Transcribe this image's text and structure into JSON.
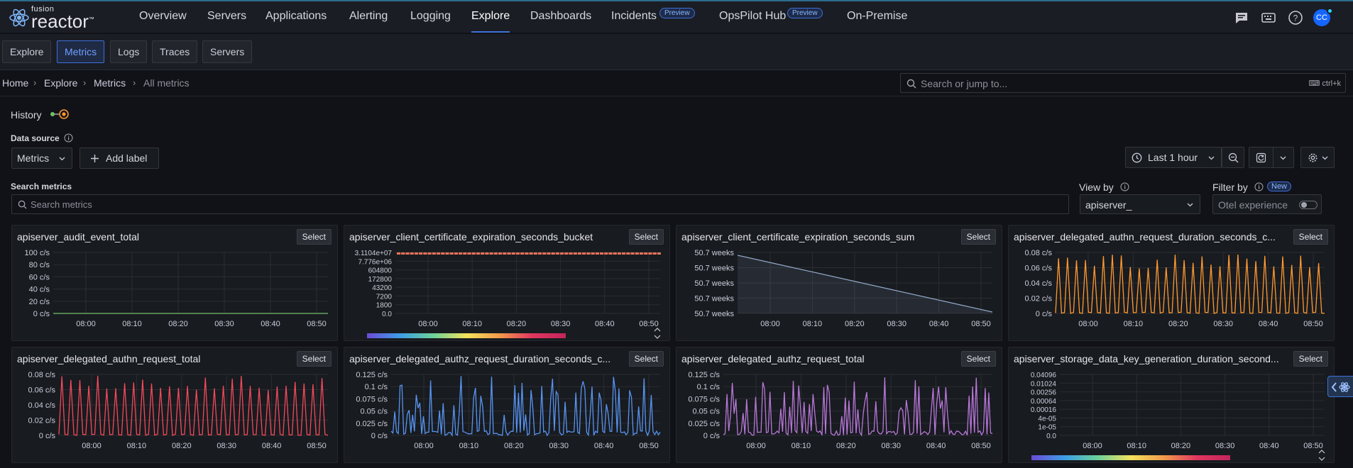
{
  "brand": {
    "top": "fusion",
    "bottom": "reactor",
    "tm": "™"
  },
  "nav": {
    "items": [
      "Overview",
      "Servers",
      "Applications",
      "Alerting",
      "Logging",
      "Explore",
      "Dashboards",
      "Incidents",
      "OpsPilot Hub",
      "On-Premise"
    ],
    "active": "Explore",
    "preview_label": "Preview"
  },
  "user": {
    "initials": "CC"
  },
  "subnav": {
    "items": [
      "Explore",
      "Metrics",
      "Logs",
      "Traces",
      "Servers"
    ],
    "active": "Metrics"
  },
  "breadcrumb": {
    "home": "Home",
    "explore": "Explore",
    "metrics": "Metrics",
    "current": "All metrics"
  },
  "jump": {
    "placeholder": "Search or jump to...",
    "shortcut": "ctrl+k"
  },
  "history_label": "History",
  "data_source": {
    "label": "Data source",
    "value": "Metrics"
  },
  "add_label": "Add label",
  "time_range": "Last 1 hour",
  "search_metrics": {
    "label": "Search metrics",
    "placeholder": "Search metrics"
  },
  "view_by": {
    "label": "View by",
    "value": "apiserver_"
  },
  "filter_by": {
    "label": "Filter by",
    "badge": "New",
    "toggle_label": "Otel experience"
  },
  "select_label": "Select",
  "time_ticks": [
    "08:00",
    "08:10",
    "08:20",
    "08:30",
    "08:40",
    "08:50"
  ],
  "colors": {
    "accent": "#3d71d9",
    "orange": "#ff9830",
    "red": "#f2495c",
    "blue": "#5794f2",
    "purple": "#b877d9",
    "green": "#73bf69"
  },
  "chart_data": [
    {
      "type": "line",
      "title": "apiserver_audit_event_total",
      "y_ticks": [
        "100 c/s",
        "80 c/s",
        "60 c/s",
        "40 c/s",
        "20 c/s",
        "0 c/s"
      ],
      "ylim": [
        0,
        100
      ],
      "series": [
        {
          "values": [
            0,
            0,
            0,
            0,
            0,
            0
          ]
        }
      ],
      "color": "#73bf69"
    },
    {
      "type": "heatmap",
      "title": "apiserver_client_certificate_expiration_seconds_bucket",
      "y_ticks": [
        "3.1104e+07",
        "7.776e+06",
        "604800",
        "172800",
        "43200",
        "7200",
        "1800",
        "0.0"
      ]
    },
    {
      "type": "area",
      "title": "apiserver_client_certificate_expiration_seconds_sum",
      "y_ticks": [
        "50.7 weeks",
        "50.7 weeks",
        "50.7 weeks",
        "50.7 weeks",
        "50.7 weeks"
      ],
      "series": [
        {
          "values": [
            1.0,
            0.8,
            0.6,
            0.4,
            0.2,
            0.0
          ]
        }
      ],
      "color": "#8fa6c5"
    },
    {
      "type": "line",
      "title": "apiserver_delegated_authn_request_duration_seconds_c...",
      "y_ticks": [
        "0.08 c/s",
        "0.06 c/s",
        "0.04 c/s",
        "0.02 c/s",
        "0 c/s"
      ],
      "ylim": [
        0,
        0.08
      ],
      "pattern": "spikes",
      "color": "#ff9830"
    },
    {
      "type": "line",
      "title": "apiserver_delegated_authn_request_total",
      "y_ticks": [
        "0.08 c/s",
        "0.06 c/s",
        "0.04 c/s",
        "0.02 c/s",
        "0 c/s"
      ],
      "ylim": [
        0,
        0.08
      ],
      "pattern": "spikes",
      "color": "#f2495c"
    },
    {
      "type": "line",
      "title": "apiserver_delegated_authz_request_duration_seconds_c...",
      "y_ticks": [
        "0.125 c/s",
        "0.1 c/s",
        "0.075 c/s",
        "0.05 c/s",
        "0.025 c/s",
        "0 c/s"
      ],
      "ylim": [
        0,
        0.125
      ],
      "pattern": "noisy",
      "color": "#5794f2"
    },
    {
      "type": "line",
      "title": "apiserver_delegated_authz_request_total",
      "y_ticks": [
        "0.125 c/s",
        "0.1 c/s",
        "0.075 c/s",
        "0.05 c/s",
        "0.025 c/s",
        "0 c/s"
      ],
      "ylim": [
        0,
        0.125
      ],
      "pattern": "noisy",
      "color": "#b877d9"
    },
    {
      "type": "heatmap",
      "title": "apiserver_storage_data_key_generation_duration_second...",
      "y_ticks": [
        "0.04096",
        "0.01024",
        "0.00256",
        "0.00064",
        "0.00016",
        "4e-05",
        "1e-05",
        "0.0"
      ]
    }
  ]
}
